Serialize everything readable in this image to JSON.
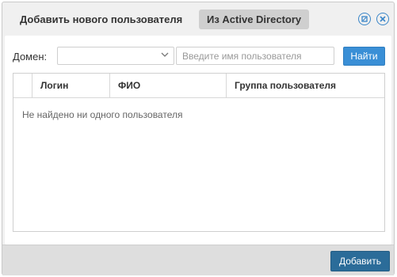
{
  "dialog": {
    "tabs": [
      {
        "label": "Добавить нового пользователя",
        "active": false
      },
      {
        "label": "Из Active Directory",
        "active": true
      }
    ],
    "icons": {
      "help": "help-icon",
      "close": "close-icon"
    }
  },
  "filter": {
    "domain_label": "Домен:",
    "domain_value": "",
    "search_placeholder": "Введите имя пользователя",
    "find_label": "Найти"
  },
  "table": {
    "columns": [
      "",
      "Логин",
      "ФИО",
      "Группа пользователя"
    ],
    "empty_text": "Не найдено ни одного пользователя"
  },
  "footer": {
    "add_label": "Добавить"
  },
  "colors": {
    "accent": "#3a8fd6",
    "primary_button": "#2b6c99",
    "active_tab": "#cfcfcf"
  }
}
